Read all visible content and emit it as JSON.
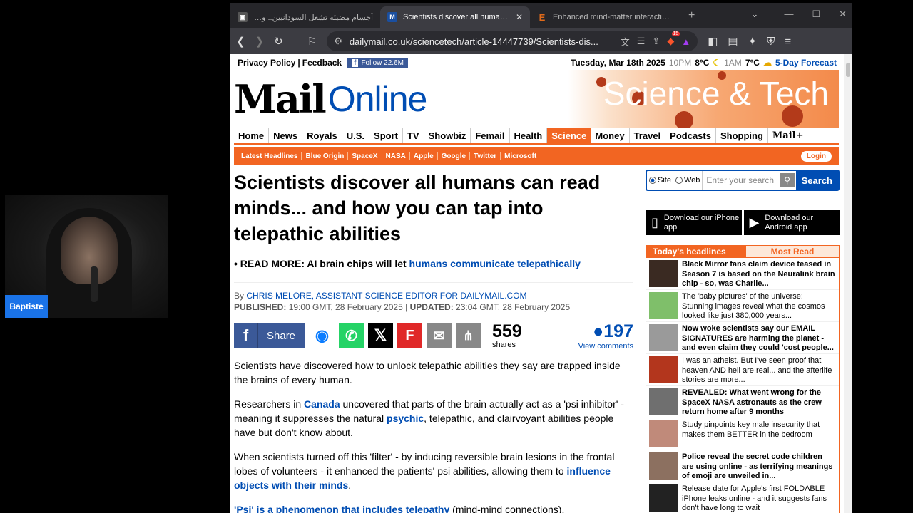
{
  "webcam": {
    "name": "Baptiste"
  },
  "tabs": [
    {
      "title": "أجسام مضيئة تشعل السودانيين.. والد",
      "fav": "",
      "fav_color": "#555",
      "close": "✕"
    },
    {
      "title": "Scientists discover all humans ca",
      "fav": "M",
      "fav_color": "#1a4fa0",
      "close": "✕"
    },
    {
      "title": "Enhanced mind-matter interactions",
      "fav": "E",
      "fav_color": "#e06a1a",
      "close": ""
    }
  ],
  "toolbar": {
    "url": "dailymail.co.uk/sciencetech/article-14447739/Scientists-dis...",
    "brave_count": "15"
  },
  "topbar": {
    "privacy": "Privacy Policy",
    "feedback": "Feedback",
    "follow": "Follow 22.6M",
    "date": "Tuesday, Mar 18th 2025",
    "t1": "10PM",
    "temp1": "8°C",
    "t2": "1AM",
    "temp2": "7°C",
    "forecast": "5-Day Forecast"
  },
  "masthead": {
    "mail": "Mail",
    "online": "Online",
    "section": "Science & Tech"
  },
  "nav": [
    "Home",
    "News",
    "Royals",
    "U.S.",
    "Sport",
    "TV",
    "Showbiz",
    "Femail",
    "Health",
    "Science",
    "Money",
    "Travel",
    "Podcasts",
    "Shopping",
    "Mail+"
  ],
  "subnav": [
    "Latest Headlines",
    "Blue Origin",
    "SpaceX",
    "NASA",
    "Apple",
    "Google",
    "Twitter",
    "Microsoft"
  ],
  "login": "Login",
  "article": {
    "headline": "Scientists discover all humans can read minds... and how you can tap into telepathic abilities",
    "readmore_label": "READ MORE:",
    "readmore_text": "AI brain chips will let",
    "readmore_link": "humans communicate telepathically",
    "by": "By",
    "author": "CHRIS MELORE, ASSISTANT SCIENCE EDITOR FOR DAILYMAIL.COM",
    "published_label": "PUBLISHED:",
    "published": "19:00 GMT, 28 February 2025",
    "updated_label": "UPDATED:",
    "updated": "23:04 GMT, 28 February 2025",
    "share_label": "Share",
    "shares": "559",
    "shares_label": "shares",
    "comments": "197",
    "comments_label": "View comments",
    "p1": "Scientists have discovered how to unlock telepathic abilities they say are trapped inside the brains of every human.",
    "p2a": "Researchers in",
    "p2link1": "Canada",
    "p2b": "uncovered that parts of the brain actually act as a 'psi inhibitor' - meaning it suppresses the natural",
    "p2link2": "psychic",
    "p2c": ", telepathic, and clairvoyant abilities people have but don't know about.",
    "p3a": "When scientists turned off this 'filter' - by inducing reversible brain lesions in the frontal lobes of volunteers - it enhanced the patients' psi abilities, allowing them to",
    "p3link": "influence objects with their minds",
    "p3b": ".",
    "p4link": "'Psi' is a phenomenon that includes telepathy",
    "p4b": "(mind-mind connections),"
  },
  "sidebar": {
    "site": "Site",
    "web": "Web",
    "placeholder": "Enter your search",
    "search_btn": "Search",
    "iphone": "Download our iPhone app",
    "android": "Download our Android app",
    "tab_today": "Today's headlines",
    "tab_most": "Most Read",
    "headlines": [
      {
        "text": "Black Mirror fans claim device teased in Season 7 is based on the Neuralink brain chip - so, was Charlie...",
        "bold": true,
        "thumb": "#3a2a22"
      },
      {
        "text": "The 'baby pictures' of the universe: Stunning images reveal what the cosmos looked like just 380,000 years...",
        "bold": false,
        "thumb": "#7fbf6a"
      },
      {
        "text": "Now woke scientists say our EMAIL SIGNATURES are harming the planet - and even claim they could 'cost people...",
        "bold": true,
        "thumb": "#9a9a9a"
      },
      {
        "text": "I was an atheist. But I've seen proof that heaven AND hell are real... and the afterlife stories are more...",
        "bold": false,
        "thumb": "#b3361d"
      },
      {
        "text": "REVEALED: What went wrong for the SpaceX NASA astronauts as the crew return home after 9 months",
        "bold": true,
        "thumb": "#6f6f6f"
      },
      {
        "text": "Study pinpoints key male insecurity that makes them BETTER in the bedroom",
        "bold": false,
        "thumb": "#c08a7a"
      },
      {
        "text": "Police reveal the secret code children are using online - as terrifying meanings of emoji are unveiled in...",
        "bold": true,
        "thumb": "#8c7060"
      },
      {
        "text": "Release date for Apple's first FOLDABLE iPhone leaks online - and it suggests fans don't have long to wait",
        "bold": false,
        "thumb": "#222222"
      }
    ]
  }
}
